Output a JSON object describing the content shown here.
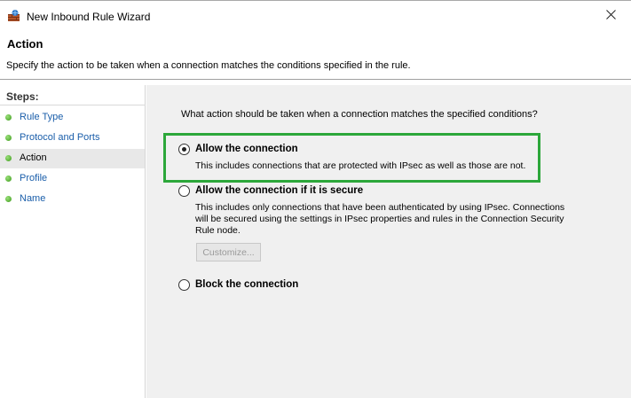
{
  "window": {
    "title": "New Inbound Rule Wizard",
    "app_icon": "firewall-icon",
    "close_icon": "close-icon"
  },
  "header": {
    "title": "Action",
    "description": "Specify the action to be taken when a connection matches the conditions specified in the rule."
  },
  "sidebar": {
    "heading": "Steps:",
    "items": [
      {
        "label": "Rule Type",
        "active": false
      },
      {
        "label": "Protocol and Ports",
        "active": false
      },
      {
        "label": "Action",
        "active": true
      },
      {
        "label": "Profile",
        "active": false
      },
      {
        "label": "Name",
        "active": false
      }
    ]
  },
  "main": {
    "question": "What action should be taken when a connection matches the specified conditions?",
    "options": [
      {
        "label": "Allow the connection",
        "selected": true,
        "description": "This includes connections that are protected with IPsec as well as those are not."
      },
      {
        "label": "Allow the connection if it is secure",
        "selected": false,
        "description_lines": [
          "This includes only connections that have been authenticated by using IPsec.  Connections",
          "will be secured using the settings in IPsec properties and rules in the Connection Security",
          "Rule node."
        ]
      },
      {
        "label": "Block the connection",
        "selected": false
      }
    ],
    "customize_label": "Customize...",
    "highlight_color": "#2ca73a"
  },
  "colors": {
    "link": "#1a5eaa",
    "panel_bg": "#f0f0f0",
    "step_dot": "#3c9a1c"
  }
}
